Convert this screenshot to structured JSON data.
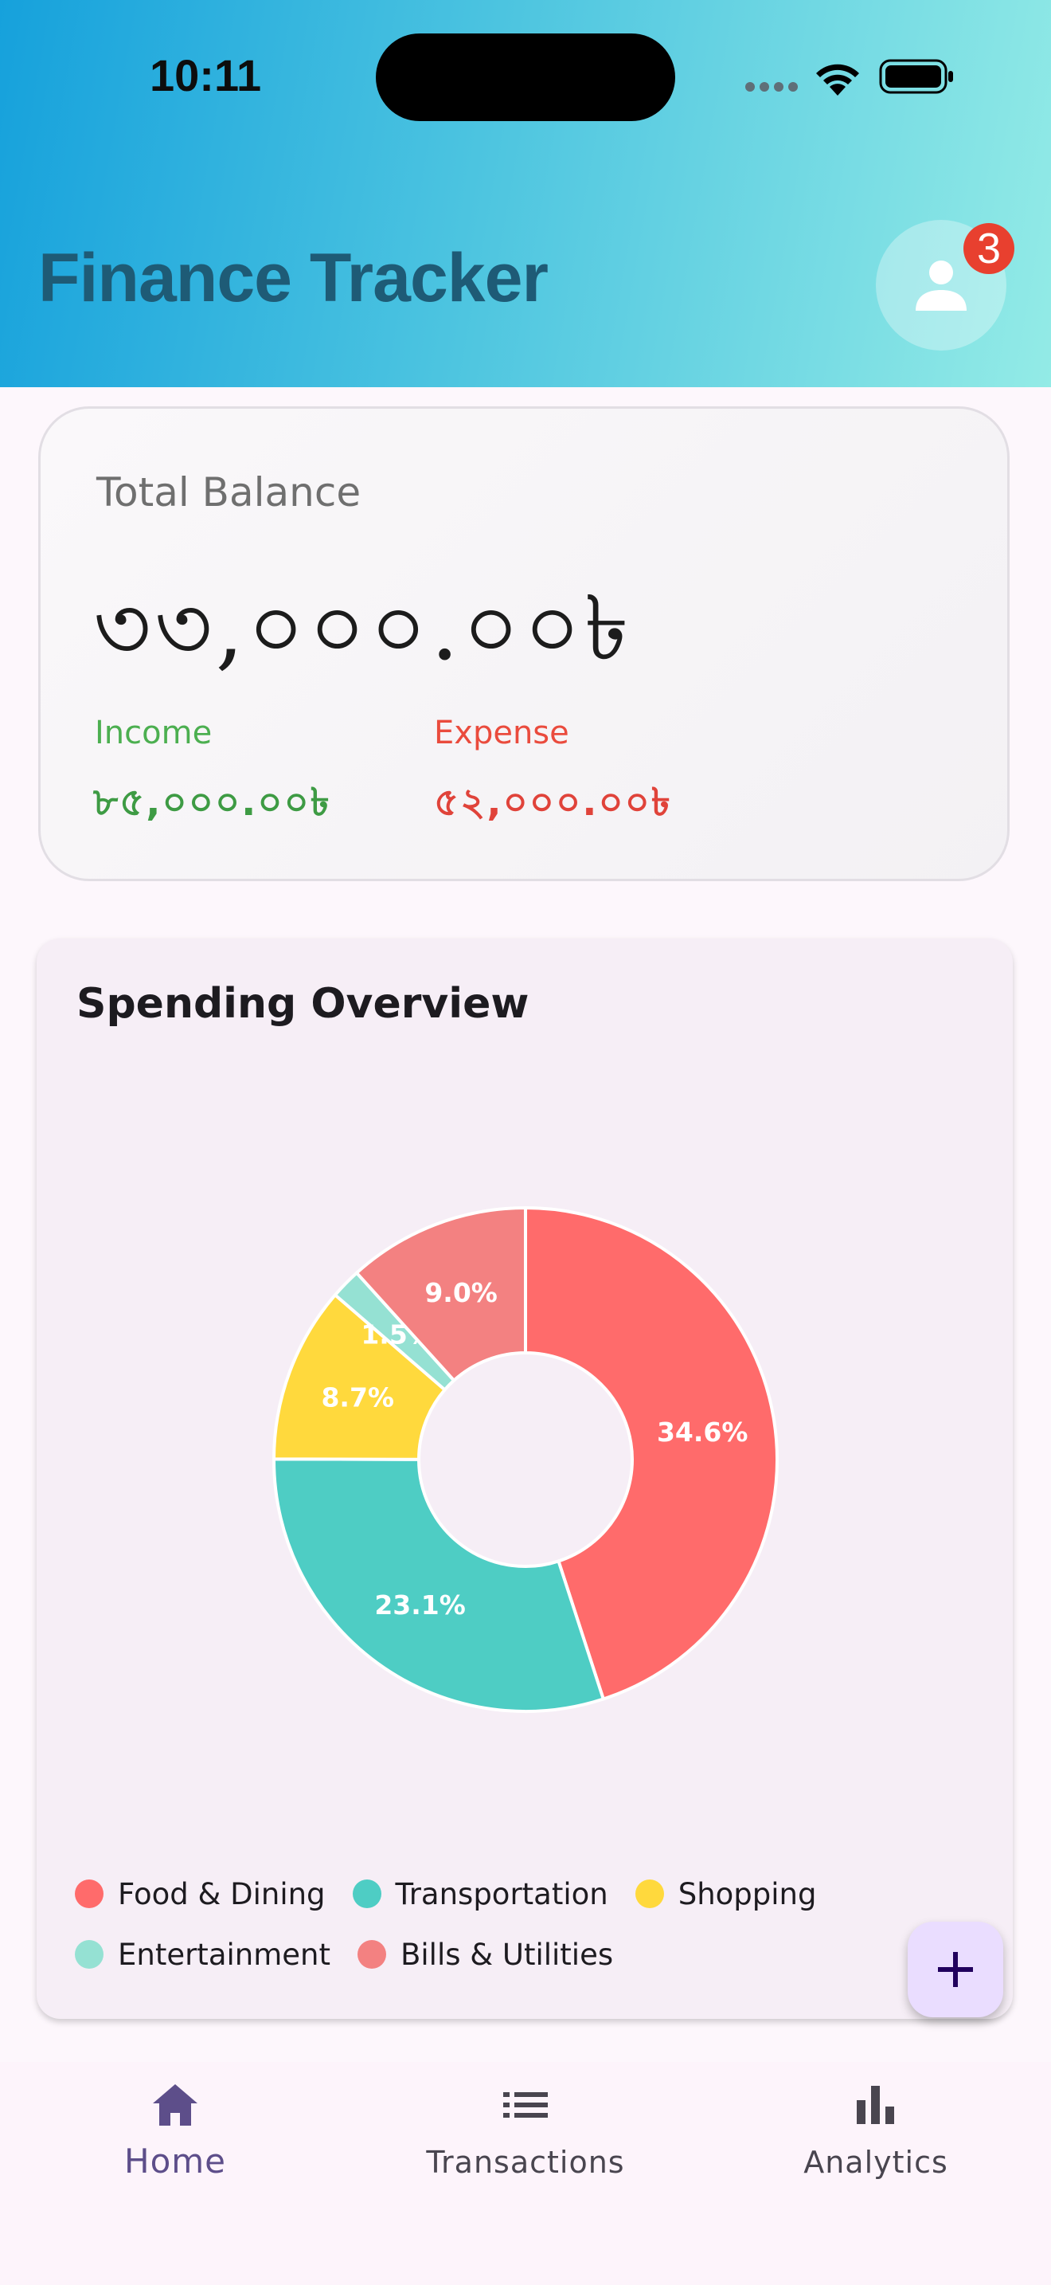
{
  "status_bar": {
    "time": "10:11"
  },
  "header": {
    "title": "Finance Tracker",
    "notification_count": "3"
  },
  "balance_card": {
    "label": "Total Balance",
    "amount": "৩৩,০০০.০০৳",
    "income_label": "Income",
    "income_value": "৮৫,০০০.০০৳",
    "expense_label": "Expense",
    "expense_value": "৫২,০০০.০০৳"
  },
  "spending": {
    "title": "Spending Overview"
  },
  "chart_data": {
    "type": "pie",
    "variant": "donut",
    "slices": [
      {
        "label": "Food & Dining",
        "percent": 34.6,
        "color": "#ff6b6b"
      },
      {
        "label": "Transportation",
        "percent": 23.1,
        "color": "#4ecdc4"
      },
      {
        "label": "Shopping",
        "percent": 8.7,
        "color": "#ffd93d"
      },
      {
        "label": "Entertainment",
        "percent": 1.5,
        "color": "#95e1d3"
      },
      {
        "label": "Bills & Utilities",
        "percent": 9.0,
        "color": "#f38181"
      }
    ],
    "value_labels": [
      "34.6%",
      "23.1%",
      "8.7%",
      "1.5%",
      "9.0%"
    ],
    "legend_position": "bottom"
  },
  "nav": {
    "items": [
      {
        "label": "Home",
        "active": true
      },
      {
        "label": "Transactions",
        "active": false
      },
      {
        "label": "Analytics",
        "active": false
      }
    ]
  },
  "colors": {
    "accent": "#5d4e8a",
    "income": "#4caf50",
    "expense": "#e0433a",
    "fab": "#eaddff"
  }
}
